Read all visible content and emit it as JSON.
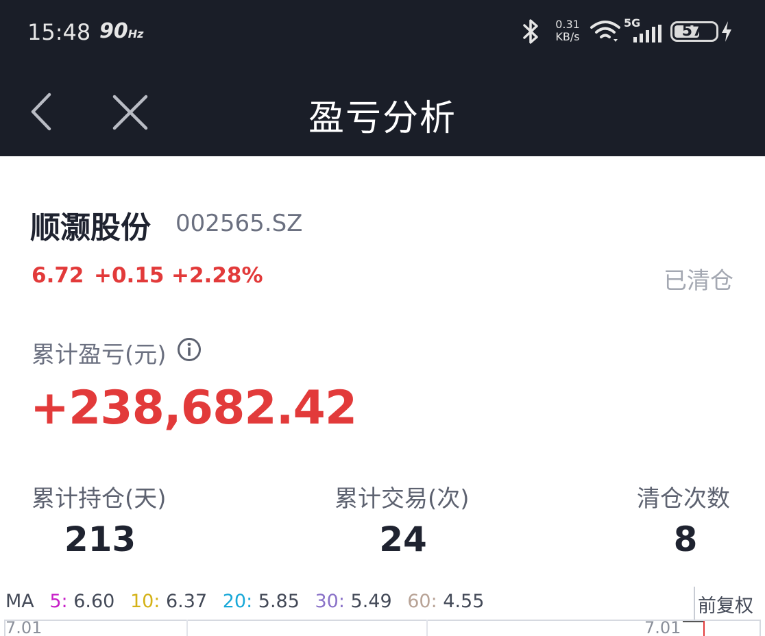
{
  "status_bar": {
    "time": "15:48",
    "refresh_rate": "90",
    "refresh_unit": "Hz",
    "net_speed_value": "0.31",
    "net_speed_unit": "KB/s",
    "network_type": "5G",
    "battery": "57"
  },
  "nav": {
    "title": "盈亏分析",
    "icons": [
      "chevron-left-icon",
      "close-icon"
    ]
  },
  "stock": {
    "name": "顺灏股份",
    "code": "002565.SZ",
    "price": "6.72",
    "change": "+0.15",
    "change_pct": "+2.28%",
    "status": "已清仓"
  },
  "cumulative": {
    "label": "累计盈亏(元)",
    "value": "+238,682.42"
  },
  "stats": [
    {
      "label": "累计持仓(天)",
      "value": "213"
    },
    {
      "label": "累计交易(次)",
      "value": "24"
    },
    {
      "label": "清仓次数",
      "value": "8"
    }
  ],
  "ma": {
    "prefix": "MA",
    "items": [
      {
        "period": "5:",
        "value": "6.60",
        "color": "#c81fc8"
      },
      {
        "period": "10:",
        "value": "6.37",
        "color": "#d4b217"
      },
      {
        "period": "20:",
        "value": "5.85",
        "color": "#19a8d8"
      },
      {
        "period": "30:",
        "value": "5.49",
        "color": "#8a72c8"
      },
      {
        "period": "60:",
        "value": "4.55",
        "color": "#b8a396"
      }
    ],
    "adjust_label": "前复权"
  },
  "chart": {
    "axis_left": "7.01",
    "axis_right": "7.01"
  },
  "colors": {
    "rise": "#e23a3a",
    "header_bg": "#1a1e28"
  }
}
